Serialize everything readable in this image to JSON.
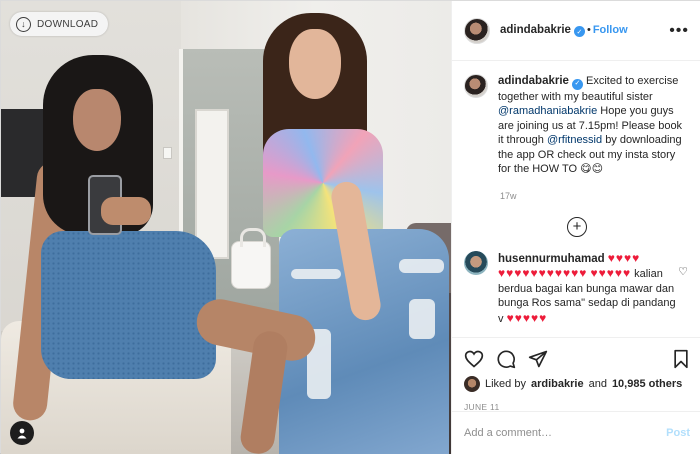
{
  "photo": {
    "download_label": "DOWNLOAD"
  },
  "post": {
    "username": "adindabakrie",
    "follow_label": "Follow",
    "caption": {
      "text_before": "Excited to exercise together with my beautiful sister",
      "mention1": "@ramadhaniabakrie",
      "text_middle": "Hope you guys are joining us at 7.15pm! Please book it through",
      "mention2": "@rfitnessid",
      "text_after": "by downloading the app OR check out my insta story for the HOW TO",
      "emoji": "😋😊"
    },
    "caption_time": "17w"
  },
  "comment": {
    "username": "husennurmuhamad",
    "hearts_line1": "♥♥♥♥",
    "hearts_line2": "♥♥♥♥♥♥♥♥♥♥♥",
    "hearts_line3": "♥♥♥♥♥",
    "text1": "kalian berdua bagai kan bunga mawar dan bunga Ros sama\" sedap di",
    "text2": "pandang v",
    "hearts_line4": "♥♥♥♥♥"
  },
  "likes": {
    "prefix": "Liked by",
    "user": "ardibakrie",
    "conj": "and",
    "count": "10,985 others"
  },
  "date": "JUNE 11",
  "add_comment": {
    "placeholder": "Add a comment…",
    "post_label": "Post"
  },
  "colors": {
    "accent": "#3897f0",
    "heart": "#ed1c3a",
    "post_disabled": "#b2dffc"
  }
}
